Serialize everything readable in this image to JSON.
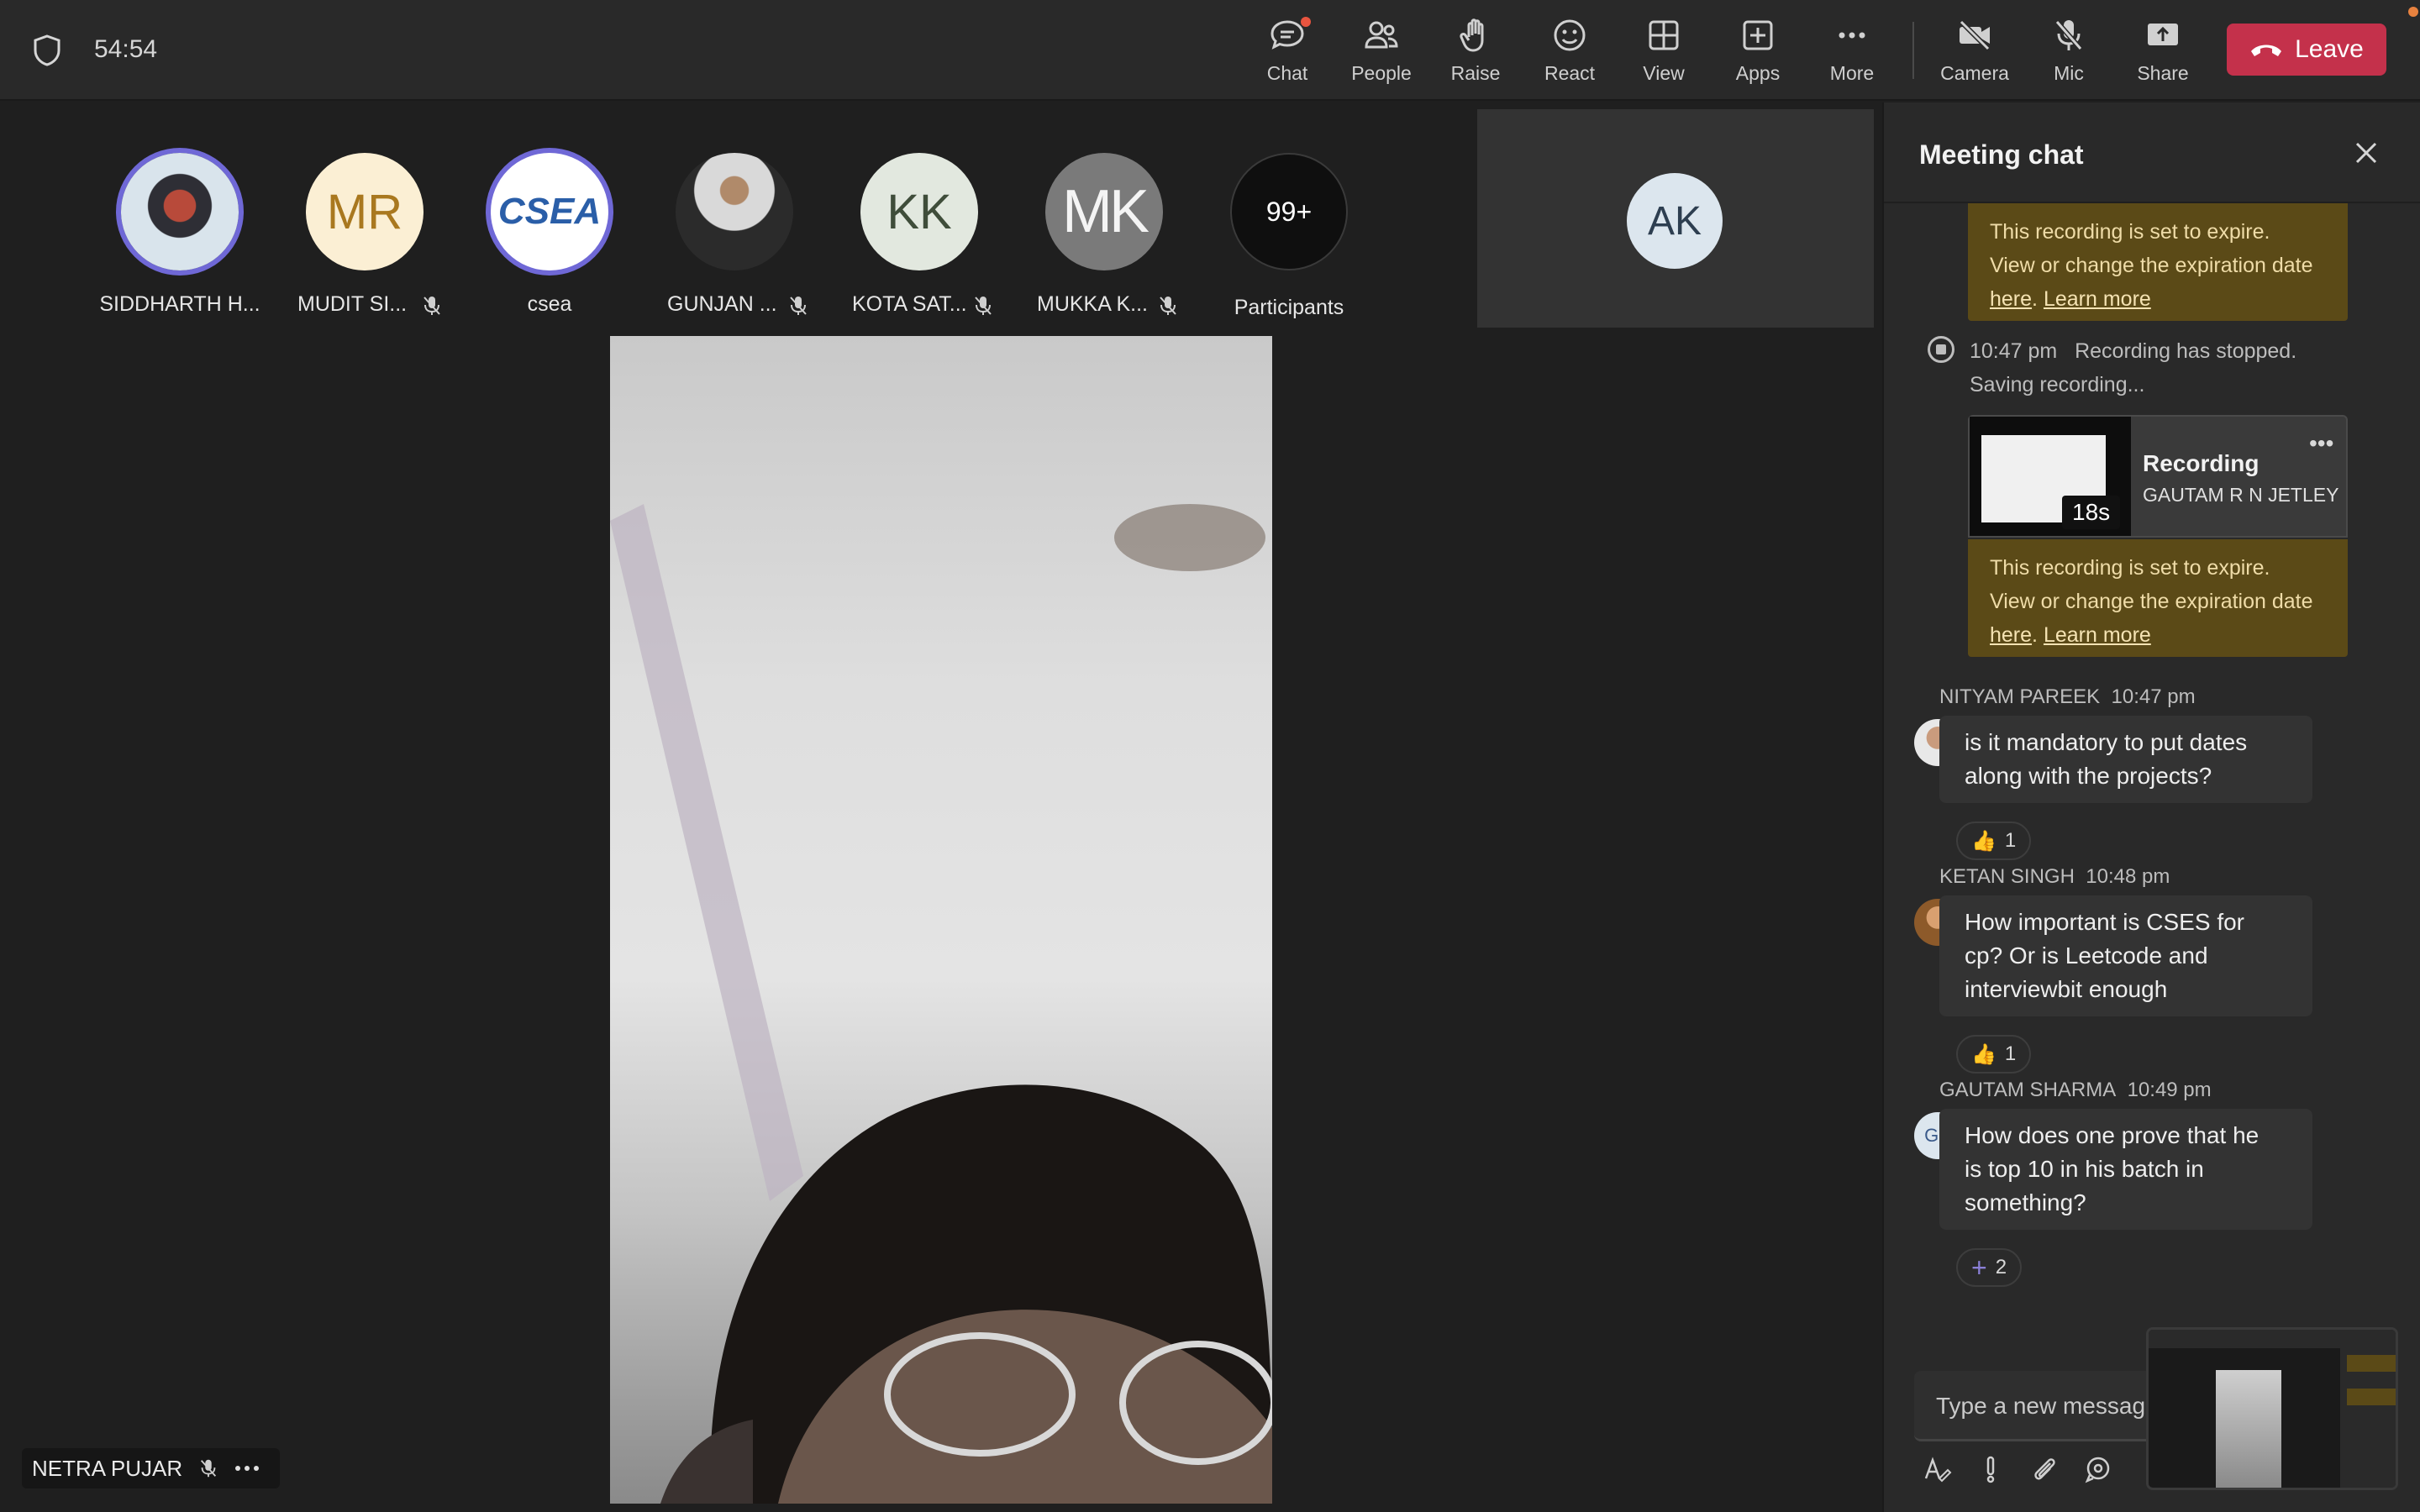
{
  "meeting": {
    "timer": "54:54"
  },
  "toolbar": {
    "chat": "Chat",
    "people": "People",
    "raise": "Raise",
    "react": "React",
    "view": "View",
    "apps": "Apps",
    "more": "More",
    "camera": "Camera",
    "mic": "Mic",
    "share": "Share",
    "leave": "Leave"
  },
  "participants": [
    {
      "name": "SIDDHARTH H...",
      "initials": "",
      "muted": false
    },
    {
      "name": "MUDIT SI...",
      "initials": "MR",
      "muted": true
    },
    {
      "name": "csea",
      "initials": "CSEA",
      "muted": false
    },
    {
      "name": "GUNJAN ...",
      "initials": "",
      "muted": true
    },
    {
      "name": "KOTA SAT...",
      "initials": "KK",
      "muted": true
    },
    {
      "name": "MUKKA K...",
      "initials": "MK",
      "muted": true
    }
  ],
  "overflow": {
    "count": "99+",
    "label": "Participants"
  },
  "side_tile": {
    "initials": "AK"
  },
  "main_video": {
    "name": "NETRA PUJAR"
  },
  "chat": {
    "title": "Meeting chat",
    "notice": {
      "line1": "This recording is set to expire.",
      "line2": "View or change the expiration date",
      "here": "here",
      "period": ".",
      "learn_more": "Learn more"
    },
    "system": {
      "time": "10:47 pm",
      "text": "Recording has stopped.",
      "text2": "Saving recording..."
    },
    "recording": {
      "title": "Recording",
      "owner": "GAUTAM R N JETLEY",
      "duration": "18s"
    },
    "messages": [
      {
        "author": "NITYAM PAREEK",
        "time": "10:47 pm",
        "line1": "is it mandatory to put dates",
        "line2": "along with the projects?",
        "line3": "",
        "reaction": "1",
        "avatar": ""
      },
      {
        "author": "KETAN SINGH",
        "time": "10:48 pm",
        "line1": "How important is CSES for",
        "line2": "cp? Or is Leetcode and",
        "line3": "interviewbit enough",
        "reaction": "1",
        "avatar": ""
      },
      {
        "author": "GAUTAM SHARMA",
        "time": "10:49 pm",
        "line1": "How does one prove that he",
        "line2": "is top 10 in his batch in",
        "line3": "something?",
        "reaction": "2",
        "avatar": "GS"
      }
    ],
    "compose_placeholder": "Type a new messag"
  },
  "colors": {
    "leave": "#c4314b",
    "accent_ring": "#6f68d6",
    "notice_bg": "#5b4a17"
  }
}
